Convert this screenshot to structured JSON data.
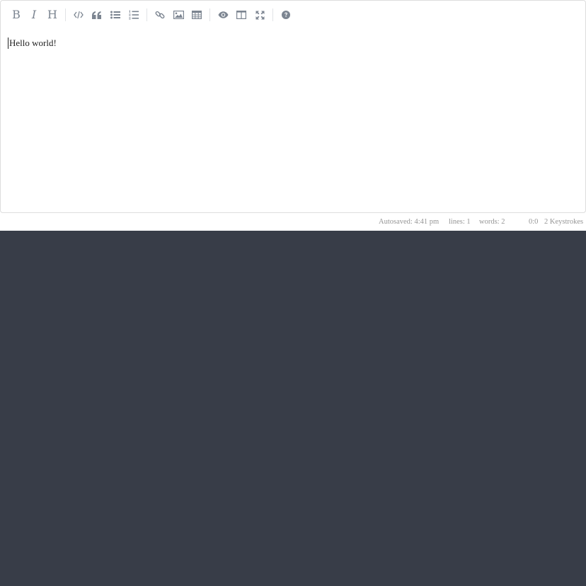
{
  "toolbar": {
    "bold_glyph": "B",
    "italic_glyph": "I",
    "heading_glyph": "H"
  },
  "editor": {
    "content": "Hello world!"
  },
  "statusbar": {
    "autosave": "Autosaved: 4:41 pm",
    "lines": "lines: 1",
    "words": "words: 2",
    "cursor": "0:0",
    "keystrokes": "2 Keystrokes"
  },
  "colors": {
    "icon": "#7c8591",
    "background": "#383d48",
    "border": "#dddddd",
    "status_text": "#959595"
  }
}
